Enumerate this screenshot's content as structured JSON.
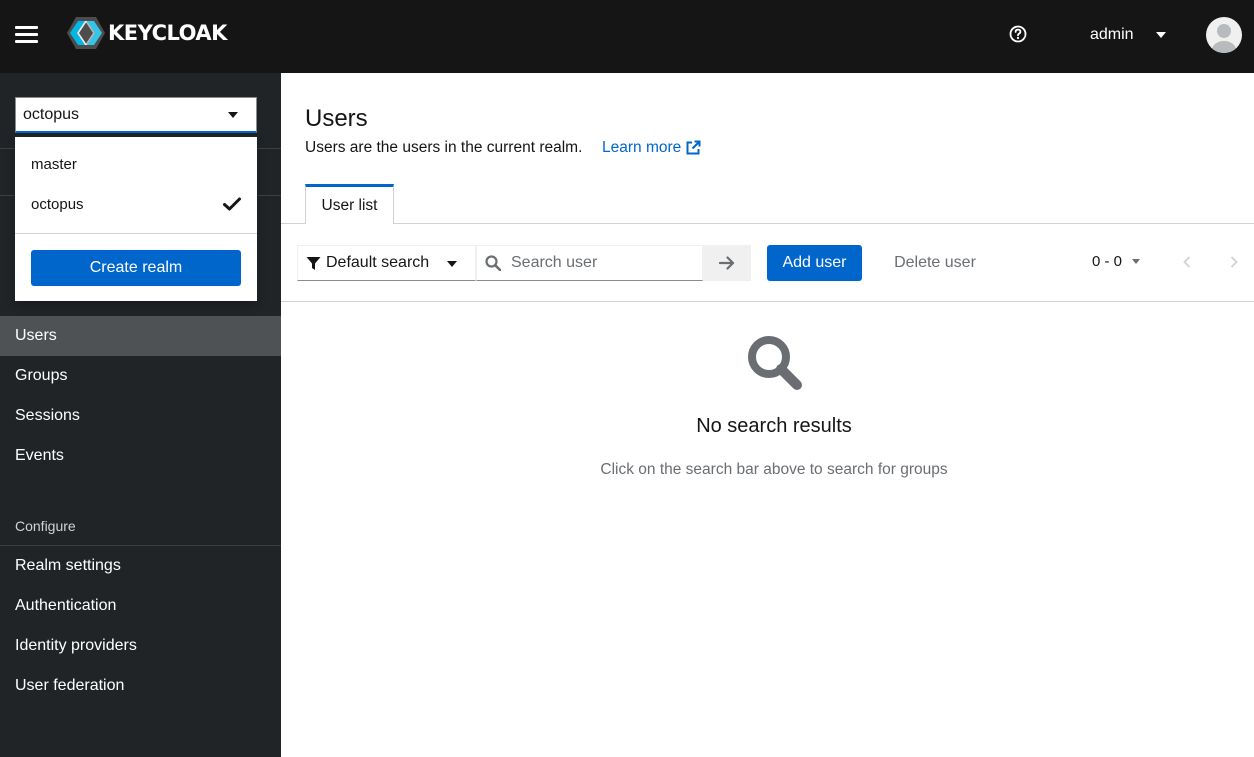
{
  "header": {
    "logo_text": "KEYCLOAK",
    "username": "admin"
  },
  "sidebar": {
    "realm_selected": "octopus",
    "nav_items": [
      "Users",
      "Groups",
      "Sessions",
      "Events"
    ],
    "configure_label": "Configure",
    "configure_items": [
      "Realm settings",
      "Authentication",
      "Identity providers",
      "User federation"
    ]
  },
  "realm_dropdown": {
    "options": [
      "master",
      "octopus"
    ],
    "checked": "octopus",
    "create_label": "Create realm"
  },
  "main": {
    "title": "Users",
    "description": "Users are the users in the current realm.",
    "learn_more": "Learn more",
    "tab_label": "User list",
    "toolbar": {
      "filter_label": "Default search",
      "search_placeholder": "Search user",
      "add_label": "Add user",
      "delete_label": "Delete user",
      "pagination": "0 - 0"
    },
    "empty": {
      "title": "No search results",
      "body": "Click on the search bar above to search for groups"
    }
  },
  "colors": {
    "header_bg": "#151515",
    "sidebar_bg": "#212427",
    "active_nav_bg": "#4f5255",
    "primary": "#0066cc"
  }
}
